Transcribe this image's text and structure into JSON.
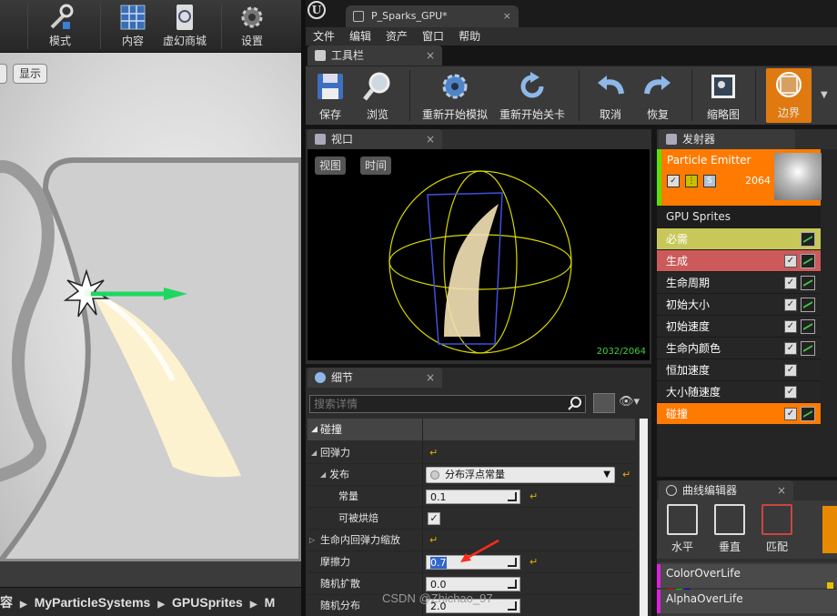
{
  "left_toolbar": {
    "mode_label": "模式",
    "content_label": "内容",
    "marketplace_label": "虚幻商城",
    "settings_label": "设置"
  },
  "left_viewport": {
    "show_label": "显示"
  },
  "breadcrumb": {
    "items": [
      "容",
      "MyParticleSystems",
      "GPUSprites",
      "M"
    ]
  },
  "document_tab": {
    "title": "P_Sparks_GPU*"
  },
  "menu": {
    "items": [
      "文件",
      "编辑",
      "资产",
      "窗口",
      "帮助"
    ]
  },
  "toolbar_panel": {
    "tab_label": "工具栏",
    "buttons": {
      "save": "保存",
      "browse": "浏览",
      "restart_sim": "重新开始模拟",
      "restart_level": "重新开始关卡",
      "undo": "取消",
      "redo": "恢复",
      "thumbnail": "缩略图",
      "bounds": "边界"
    }
  },
  "viewport_panel": {
    "tab_label": "视口",
    "view_label": "视图",
    "time_label": "时间",
    "particle_count": "2032/2064"
  },
  "details_panel": {
    "tab_label": "细节",
    "search_placeholder": "搜索详情",
    "category": "碰撞",
    "rows": {
      "restitution": "回弹力",
      "distribution": "发布",
      "distribution_value": "分布浮点常量",
      "constant": "常量",
      "constant_value": "0.1",
      "can_bake": "可被烘焙",
      "restitution_scale": "生命内回弹力缩放",
      "friction": "摩擦力",
      "friction_value": "0.7",
      "random_spread": "随机扩散",
      "random_spread_value": "0.0",
      "random_distribution": "随机分布",
      "random_distribution_value": "2.0"
    }
  },
  "emitters_panel": {
    "tab_label": "发射器",
    "emitter_name": "Particle Emitter",
    "emitter_count": "2064",
    "emitter_type": "GPU Sprites",
    "modules": [
      {
        "label": "必需",
        "color": "#c8c85a"
      },
      {
        "label": "生成",
        "color": "#cc5a5a"
      },
      {
        "label": "生命周期",
        "color": "#262626"
      },
      {
        "label": "初始大小",
        "color": "#262626"
      },
      {
        "label": "初始速度",
        "color": "#262626"
      },
      {
        "label": "生命内颜色",
        "color": "#262626"
      },
      {
        "label": "恒加速度",
        "color": "#262626"
      },
      {
        "label": "大小随速度",
        "color": "#262626"
      },
      {
        "label": "碰撞",
        "color": "#ff7a00"
      }
    ]
  },
  "curve_editor": {
    "tab_label": "曲线编辑器",
    "horizontal_label": "水平",
    "vertical_label": "垂直",
    "fit_label": "匹配",
    "curves": [
      "ColorOverLife",
      "AlphaOverLife"
    ]
  },
  "watermark": "CSDN @Zhichao_97",
  "colors": {
    "accent_orange": "#ff7a00",
    "emitter_active_green": "#5ce000",
    "curve_magenta": "#e020e0",
    "reset_yellow": "#e8b000"
  }
}
